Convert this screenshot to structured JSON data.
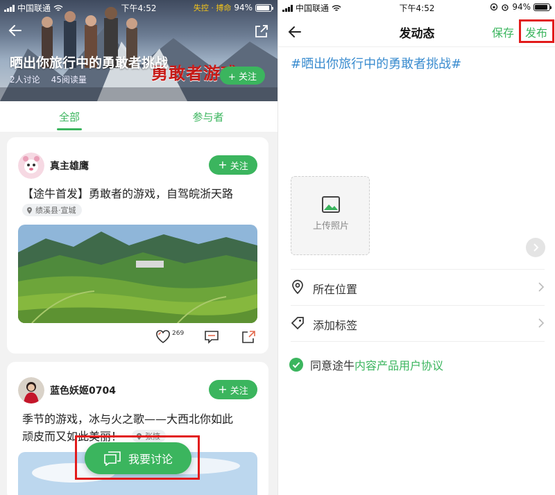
{
  "left_status": {
    "carrier": "中国联通",
    "time": "下午4:52",
    "battery": "94%",
    "banner": "失控 · 搏命"
  },
  "right_status": {
    "carrier": "中国联通",
    "time": "下午4:52",
    "battery": "94%"
  },
  "topic": {
    "title": "晒出你旅行中的勇敢者挑战",
    "discussions": "2人讨论",
    "reads": "45阅读量",
    "follow_label": "+ 关注",
    "poster_text": "勇敢者游戏2"
  },
  "tabs": [
    {
      "label": "全部",
      "active": true
    },
    {
      "label": "参与者",
      "active": false
    }
  ],
  "posts": [
    {
      "username": "真主雄鹰",
      "follow_label": "关注",
      "text": "【途牛首发】勇敢者的游戏，自驾皖浙天路",
      "location": "绩溪县·宣城",
      "likes": "269"
    },
    {
      "username": "蓝色妖姬0704",
      "follow_label": "关注",
      "text_line1": "季节的游戏，冰与火之歌——大西北你如此",
      "text_line2": "顽皮而又如此美丽！",
      "location": "张掖"
    }
  ],
  "discuss_button": {
    "label": "我要讨论"
  },
  "compose": {
    "title": "发动态",
    "save_label": "保存",
    "publish_label": "发布",
    "topic_tag": "#晒出你旅行中的勇敢者挑战#",
    "upload_label": "上传照片",
    "location_label": "所在位置",
    "tag_label": "添加标签",
    "agree_prefix": "同意途牛",
    "agree_link": "内容产品用户协议"
  },
  "colors": {
    "accent": "#3bb55e",
    "highlight": "#e21b1b",
    "topic": "#3a8ccf"
  }
}
